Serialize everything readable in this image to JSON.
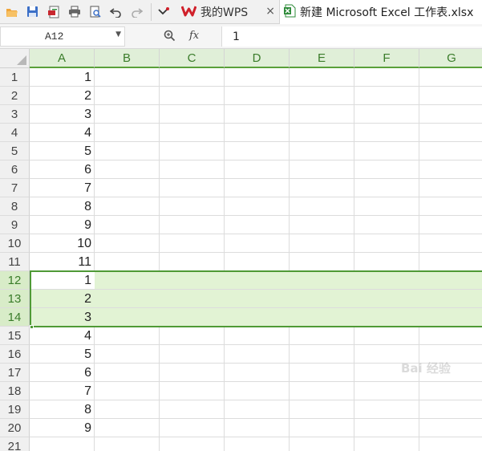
{
  "toolbar": {
    "icons": [
      "open-folder-icon",
      "save-icon",
      "export-pdf-icon",
      "print-icon",
      "print-preview-icon",
      "undo-icon",
      "redo-icon",
      "customize-dropdown-icon"
    ]
  },
  "tabs": [
    {
      "label": "我的WPS",
      "icon": "wps-logo-icon",
      "close": "×"
    },
    {
      "label": "新建 Microsoft Excel 工作表.xlsx",
      "icon": "excel-file-icon"
    }
  ],
  "formula_bar": {
    "name_box": "A12",
    "formula_value": "1",
    "fx_label": "fx"
  },
  "sheet": {
    "columns": [
      "A",
      "B",
      "C",
      "D",
      "E",
      "F",
      "G"
    ],
    "selected_columns": [
      "A",
      "B",
      "C",
      "D",
      "E",
      "F",
      "G"
    ],
    "rows": [
      {
        "num": "1",
        "a": "1"
      },
      {
        "num": "2",
        "a": "2"
      },
      {
        "num": "3",
        "a": "3"
      },
      {
        "num": "4",
        "a": "4"
      },
      {
        "num": "5",
        "a": "5"
      },
      {
        "num": "6",
        "a": "6"
      },
      {
        "num": "7",
        "a": "7"
      },
      {
        "num": "8",
        "a": "8"
      },
      {
        "num": "9",
        "a": "9"
      },
      {
        "num": "10",
        "a": "10"
      },
      {
        "num": "11",
        "a": "11"
      },
      {
        "num": "12",
        "a": "1",
        "selected": true,
        "active": true
      },
      {
        "num": "13",
        "a": "2",
        "selected": true
      },
      {
        "num": "14",
        "a": "3",
        "selected": true
      },
      {
        "num": "15",
        "a": "4"
      },
      {
        "num": "16",
        "a": "5"
      },
      {
        "num": "17",
        "a": "6"
      },
      {
        "num": "18",
        "a": "7"
      },
      {
        "num": "19",
        "a": "8"
      },
      {
        "num": "20",
        "a": "9"
      },
      {
        "num": "21",
        "a": ""
      }
    ]
  },
  "colors": {
    "selection_border": "#4f9a36",
    "selection_fill": "#e2f3d4",
    "selected_header_text": "#3a7c2a",
    "wps_logo": "#d0202a",
    "excel_icon": "#2e8b3a"
  },
  "watermark": "百度经验"
}
